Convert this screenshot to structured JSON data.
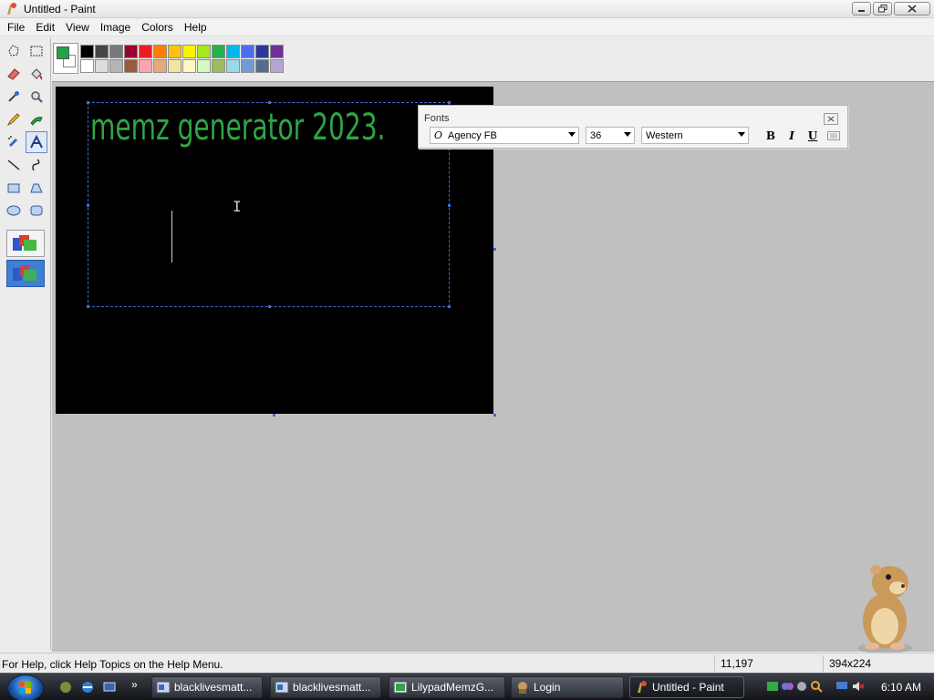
{
  "window": {
    "title": "Untitled - Paint"
  },
  "menu": [
    "File",
    "Edit",
    "View",
    "Image",
    "Colors",
    "Help"
  ],
  "palette": {
    "foreground": "#22a447",
    "background": "#ffffff",
    "row1": [
      "#000000",
      "#464646",
      "#787878",
      "#990030",
      "#ed1c24",
      "#ff7e00",
      "#ffc20e",
      "#fff200",
      "#a8e61d",
      "#22b14c",
      "#00b7ef",
      "#4d6df3",
      "#2f3699",
      "#6f3198"
    ],
    "row2": [
      "#ffffff",
      "#dcdcdc",
      "#b4b4b4",
      "#9c5a3c",
      "#ffa3b1",
      "#e5aa7a",
      "#f5e49c",
      "#fff9bd",
      "#d3f9bc",
      "#9dbb61",
      "#99d9ea",
      "#709ad1",
      "#546d8e",
      "#b5a5d5"
    ]
  },
  "canvas": {
    "text": "memz generator 2023.",
    "text_color": "#2fa545",
    "background": "#000000"
  },
  "fonts_toolbar": {
    "title": "Fonts",
    "font_name": "Agency FB",
    "font_size": "36",
    "script": "Western",
    "bold_label": "B",
    "italic_label": "I",
    "underline_label": "U"
  },
  "status": {
    "help_text": "For Help, click Help Topics on the Help Menu.",
    "cursor_pos": "11,197",
    "selection_size": "394x224"
  },
  "taskbar": {
    "buttons": [
      "blacklivesmatt...",
      "blacklivesmatt...",
      "LilypadMemzG...",
      "Login",
      "Untitled - Paint"
    ],
    "clock": "6:10 AM"
  }
}
